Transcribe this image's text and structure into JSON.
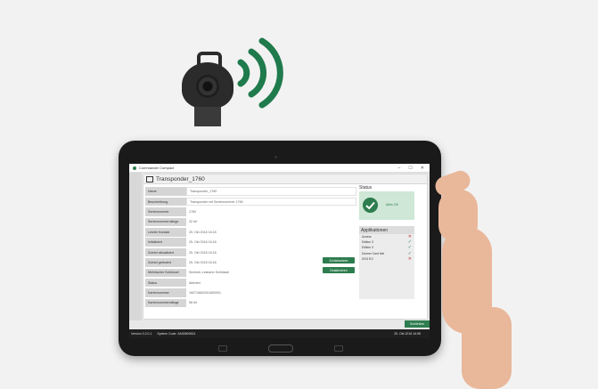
{
  "window": {
    "title": "Commander Compact",
    "min": "–",
    "max": "☐",
    "close": "✕"
  },
  "document": {
    "title": "Transponder_1760"
  },
  "fields": [
    {
      "label": "Name",
      "value": "Transponder_1760",
      "boxed": true
    },
    {
      "label": "Beschreibung",
      "value": "Transponder mit Seriennummer 1760",
      "boxed": true
    },
    {
      "label": "Seriennummer",
      "value": "1760",
      "boxed": false
    },
    {
      "label": "Seriennummernlänge",
      "value": "32 bit",
      "boxed": false
    },
    {
      "label": "Letzter Kontakt",
      "value": "25. Okt 2018 16:18",
      "boxed": false
    },
    {
      "label": "Initialisiert",
      "value": "25. Okt 2018 16:18",
      "boxed": false
    },
    {
      "label": "Zuletzt aktualisiert",
      "value": "25. Okt 2018 16:18",
      "boxed": false
    },
    {
      "label": "Zuletzt geändert",
      "value": "25. Okt 2018 16:18",
      "boxed": false
    },
    {
      "label": "Mehrfacher Schlüssel",
      "value": "Sicherer-Lesbarer Schlüssel",
      "boxed": false
    },
    {
      "label": "Status",
      "value": "Aktiviert",
      "boxed": false
    },
    {
      "label": "Kartennummer",
      "value": "160716602001800001",
      "boxed": false
    },
    {
      "label": "Kartennummernlänge",
      "value": "56 bit",
      "boxed": false
    }
  ],
  "buttons": {
    "reset": "Zurücksetzen",
    "deactivate": "Deaktivieren",
    "save": "Schließen"
  },
  "status": {
    "header": "Status",
    "text": "Alles OK"
  },
  "apps": {
    "header": "Applikationen",
    "items": [
      {
        "name": "Access",
        "ok": false
      },
      {
        "name": "Edition 3",
        "ok": true
      },
      {
        "name": "Edition 3",
        "ok": true
      },
      {
        "name": "Dormer Card Net",
        "ok": true
      },
      {
        "name": "DSG EO",
        "ok": false
      }
    ]
  },
  "statusbar": {
    "version": "Version 3.2.0.1",
    "system": "System Code: 0A00800B01",
    "date": "25. Okt 2018 16:58"
  },
  "colors": {
    "accent": "#2e7d4f",
    "error": "#c0392b",
    "tablet": "#1a1a1a"
  },
  "icons": {
    "check": "check-circle-icon",
    "ok": "checkmark-icon",
    "fail": "cross-icon",
    "signal": "wireless-signal-icon"
  }
}
